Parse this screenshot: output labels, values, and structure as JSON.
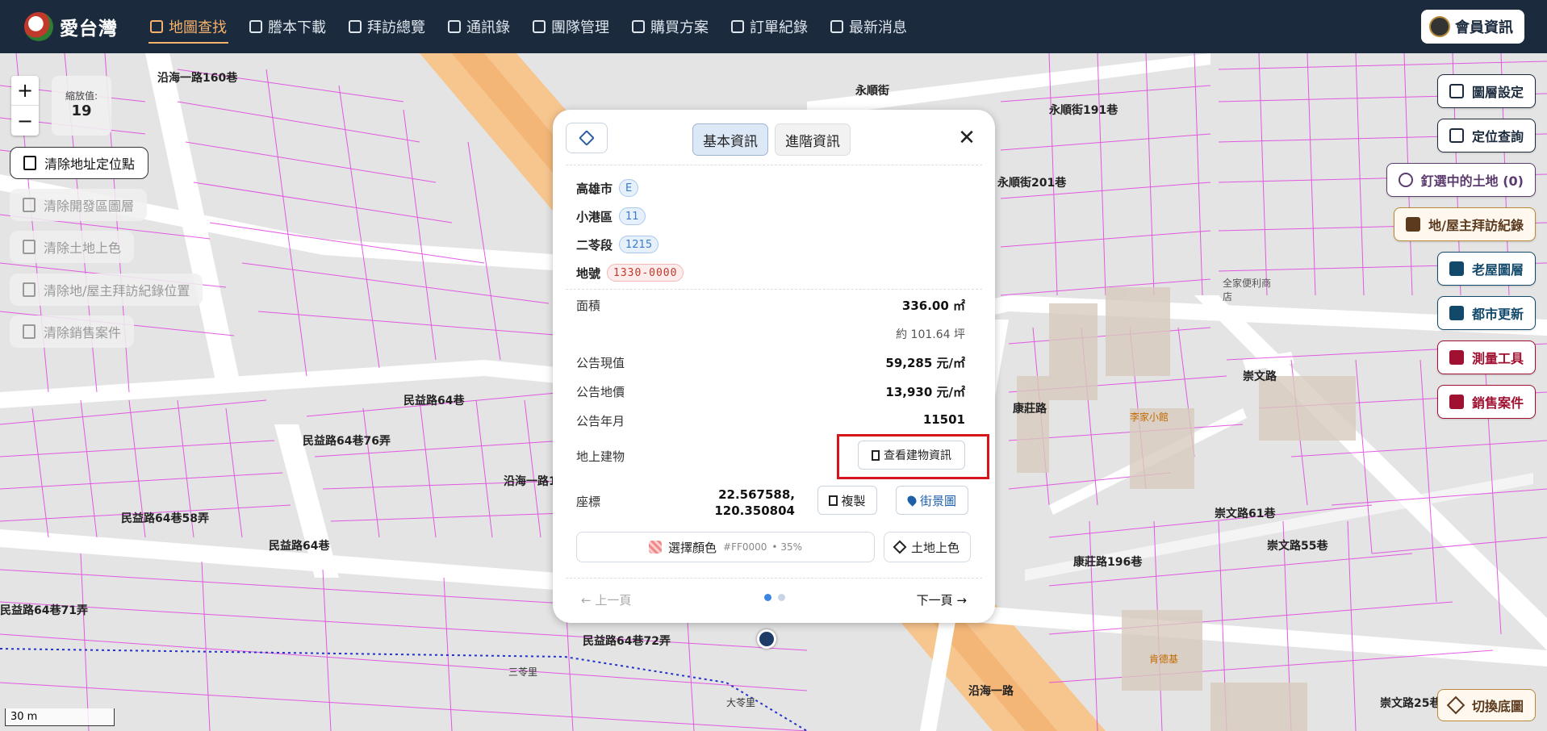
{
  "app": {
    "name": "愛台灣"
  },
  "nav": {
    "items": [
      {
        "label": "地圖查找",
        "icon": "map-icon"
      },
      {
        "label": "謄本下載",
        "icon": "document-icon"
      },
      {
        "label": "拜訪總覽",
        "icon": "chart-icon"
      },
      {
        "label": "通訊錄",
        "icon": "contact-card-icon"
      },
      {
        "label": "團隊管理",
        "icon": "team-icon"
      },
      {
        "label": "購買方案",
        "icon": "folder-icon"
      },
      {
        "label": "訂單紀錄",
        "icon": "receipt-icon"
      },
      {
        "label": "最新消息",
        "icon": "news-icon"
      }
    ],
    "active_index": 0,
    "member_label": "會員資訊"
  },
  "zoom": {
    "plus": "+",
    "minus": "−",
    "label": "縮放值:",
    "value": "19"
  },
  "left_buttons": [
    {
      "label": "清除地址定位點",
      "enabled": true
    },
    {
      "label": "清除開發區圖層",
      "enabled": false
    },
    {
      "label": "清除土地上色",
      "enabled": false
    },
    {
      "label": "清除地/屋主拜訪紀錄位置",
      "enabled": false
    },
    {
      "label": "清除銷售案件",
      "enabled": false
    }
  ],
  "right_buttons": [
    {
      "label": "圖層設定",
      "icon": "sliders-icon"
    },
    {
      "label": "定位查詢",
      "icon": "location-pin-icon"
    },
    {
      "label": "釘選中的土地 (0)",
      "icon": "person-pin-icon"
    },
    {
      "label": "地/屋主拜訪紀錄",
      "icon": "visit-record-icon"
    },
    {
      "label": "老屋圖層",
      "icon": "house-icon"
    },
    {
      "label": "都市更新",
      "icon": "building-icon"
    },
    {
      "label": "測量工具",
      "icon": "ruler-icon"
    },
    {
      "label": "銷售案件",
      "icon": "megaphone-icon"
    }
  ],
  "switch_basemap": "切換底圖",
  "scale": "30 m",
  "card": {
    "tabs": [
      "基本資訊",
      "進階資訊"
    ],
    "close": "✕",
    "city": {
      "label": "高雄市",
      "code": "E"
    },
    "district": {
      "label": "小港區",
      "code": "11"
    },
    "section": {
      "label": "二苓段",
      "code": "1215"
    },
    "lot": {
      "label": "地號",
      "code": "1330-0000"
    },
    "area": {
      "label": "面積",
      "value": "336.00 ㎡",
      "ping": "約 101.64 坪"
    },
    "current_value": {
      "label": "公告現值",
      "value": "59,285 元/㎡"
    },
    "land_price": {
      "label": "公告地價",
      "value": "13,930 元/㎡"
    },
    "year": {
      "label": "公告年月",
      "value": "11501"
    },
    "building": {
      "label": "地上建物",
      "button": "查看建物資訊"
    },
    "coords": {
      "label": "座標",
      "lat": "22.567588,",
      "lng": "120.350804",
      "copy": "複製",
      "street": "街景圖"
    },
    "color": {
      "label": "選擇顏色",
      "hex": "#FF0000",
      "opacity": "• 35%",
      "paint": "土地上色"
    },
    "prev": "← 上一頁",
    "next": "下一頁 →",
    "page_dots": 2,
    "active_dot": 0
  },
  "map_labels": {
    "roads": [
      "民益路64巷",
      "沿海一路160巷",
      "民益路64巷58弄",
      "民益路64巷76弄",
      "民益路64巷71弄",
      "民益路64巷72弄",
      "康莊路",
      "崇文路",
      "崇文路61巷",
      "崇文路55巷",
      "永順街",
      "沿海一路",
      "沿海一路160巷",
      "民益路64巷",
      "永順街201巷",
      "永順街191巷",
      "康莊路196巷",
      "崇文路25巷",
      "三苓里",
      "大苓里"
    ],
    "places": [
      "全家便利商店",
      "李家小館",
      "肯德基"
    ]
  },
  "colors": {
    "nav_bg": "#1b2a3d",
    "accent": "#f6b26b",
    "highlight": "#d6161c",
    "parcel_line": "#e040e0"
  }
}
